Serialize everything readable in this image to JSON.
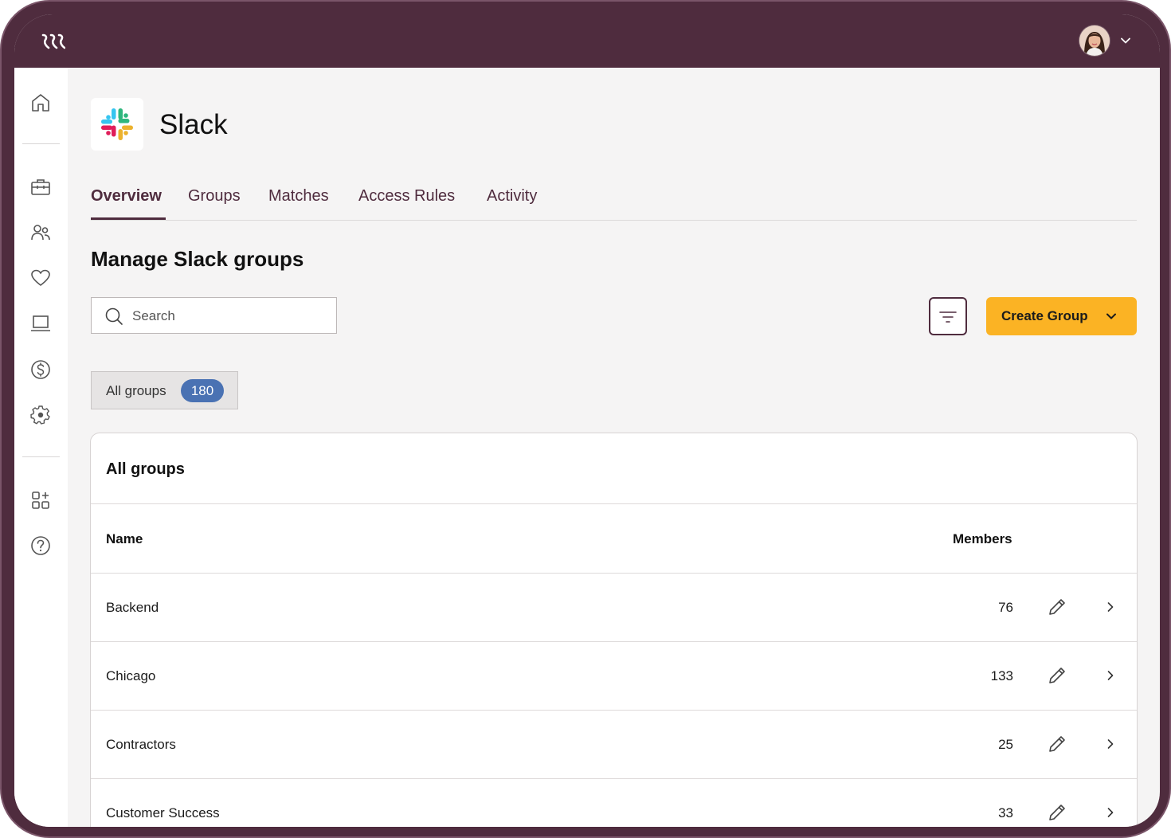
{
  "header": {
    "logo_icon": "rippling-logo-icon",
    "avatar_icon": "user-avatar",
    "menu_icon": "chevron-down-icon"
  },
  "sidebar": {
    "items": [
      {
        "icon": "home-icon"
      },
      {
        "icon": "briefcase-icon"
      },
      {
        "icon": "people-icon"
      },
      {
        "icon": "heart-icon"
      },
      {
        "icon": "laptop-icon"
      },
      {
        "icon": "dollar-icon"
      },
      {
        "icon": "settings-gear-icon"
      },
      {
        "icon": "apps-add-icon"
      },
      {
        "icon": "help-icon"
      }
    ]
  },
  "app": {
    "name": "Slack",
    "logo_icon": "slack-logo-icon"
  },
  "tabs": [
    {
      "label": "Overview",
      "active": true
    },
    {
      "label": "Groups"
    },
    {
      "label": "Matches"
    },
    {
      "label": "Access Rules"
    },
    {
      "label": "Activity"
    }
  ],
  "section": {
    "title": "Manage Slack groups"
  },
  "search": {
    "placeholder": "Search",
    "icon": "search-icon"
  },
  "filter_button": {
    "icon": "filter-icon"
  },
  "create_button": {
    "label": "Create Group",
    "icon": "chevron-down-icon"
  },
  "chip": {
    "label": "All groups",
    "count": "180"
  },
  "card": {
    "title": "All groups",
    "columns": {
      "name": "Name",
      "members": "Members"
    },
    "rows": [
      {
        "name": "Backend",
        "members": "76"
      },
      {
        "name": "Chicago",
        "members": "133"
      },
      {
        "name": "Contractors",
        "members": "25"
      },
      {
        "name": "Customer Success",
        "members": "33"
      }
    ]
  },
  "colors": {
    "brand": "#4f2c3e",
    "accent": "#fbb324",
    "badge": "#4a72b3"
  }
}
